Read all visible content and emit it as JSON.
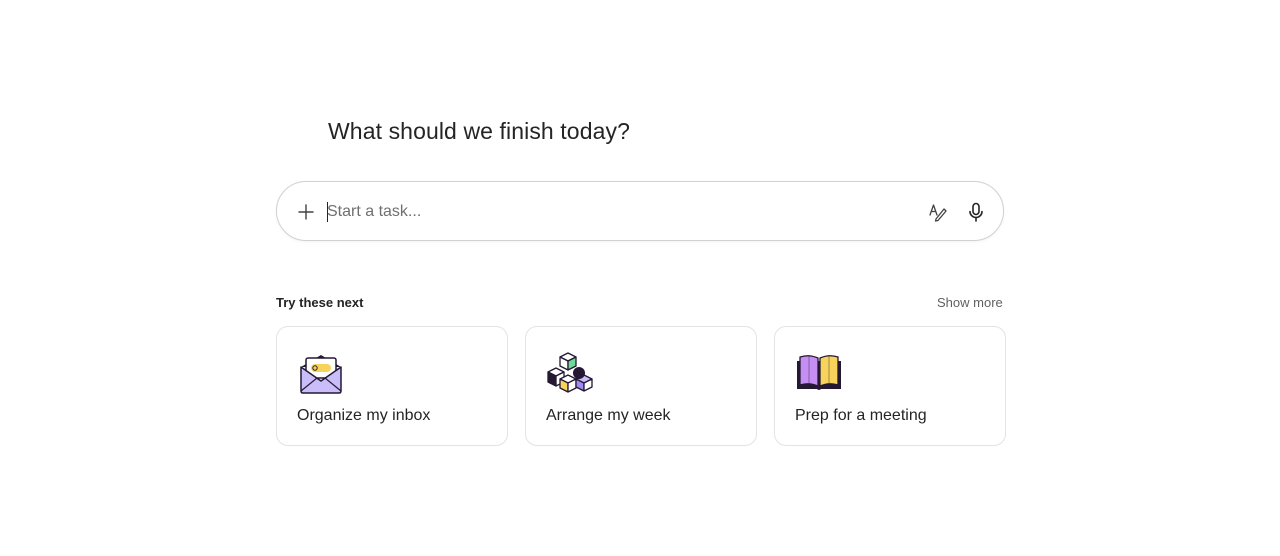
{
  "heading": "What should we finish today?",
  "composer": {
    "placeholder": "Start a task..."
  },
  "suggestions": {
    "section_label": "Try these next",
    "show_more_label": "Show more",
    "cards": [
      {
        "label": "Organize my inbox",
        "icon": "envelope-icon"
      },
      {
        "label": "Arrange my week",
        "icon": "cubes-icon"
      },
      {
        "label": "Prep for a meeting",
        "icon": "open-book-icon"
      }
    ]
  },
  "colors": {
    "border": "#d1d1d1",
    "card_border": "#e3e3e3",
    "text": "#242424",
    "muted": "#616161",
    "icon_purple": "#9f8bf0",
    "icon_yellow": "#f7d35c",
    "icon_green": "#6fd99a",
    "icon_dark": "#241832"
  }
}
